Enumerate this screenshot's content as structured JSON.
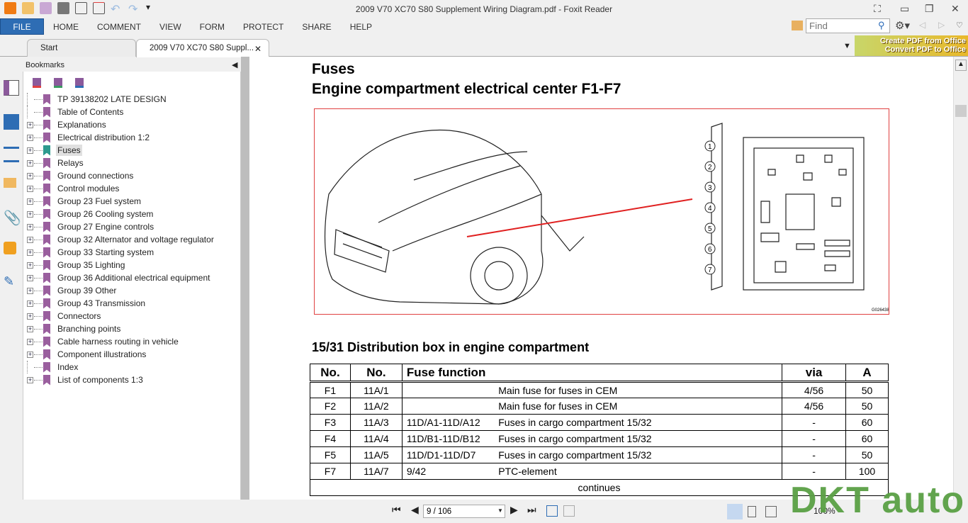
{
  "window": {
    "title": "2009 V70 XC70 S80 Supplement Wiring Diagram.pdf - Foxit Reader"
  },
  "menu": {
    "file": "FILE",
    "items": [
      "HOME",
      "COMMENT",
      "VIEW",
      "FORM",
      "PROTECT",
      "SHARE",
      "HELP"
    ]
  },
  "search": {
    "placeholder": "Find"
  },
  "tabs": [
    {
      "label": "Start"
    },
    {
      "label": "2009 V70 XC70 S80 Suppl..."
    }
  ],
  "banner": {
    "line1": "Create PDF from Office",
    "line2": "Convert PDF to Office"
  },
  "bookmarks": {
    "title": "Bookmarks",
    "items": [
      {
        "label": "TP 39138202 LATE DESIGN",
        "expandable": false
      },
      {
        "label": "Table of Contents",
        "expandable": false
      },
      {
        "label": "Explanations",
        "expandable": true
      },
      {
        "label": "Electrical distribution 1:2",
        "expandable": true
      },
      {
        "label": "Fuses",
        "expandable": true,
        "selected": true
      },
      {
        "label": "Relays",
        "expandable": true
      },
      {
        "label": "Ground connections",
        "expandable": true
      },
      {
        "label": "Control modules",
        "expandable": true
      },
      {
        "label": "Group 23 Fuel system",
        "expandable": true
      },
      {
        "label": "Group 26 Cooling system",
        "expandable": true
      },
      {
        "label": "Group 27 Engine controls",
        "expandable": true
      },
      {
        "label": "Group 32 Alternator and voltage regulator",
        "expandable": true
      },
      {
        "label": "Group 33 Starting system",
        "expandable": true
      },
      {
        "label": "Group 35 Lighting",
        "expandable": true
      },
      {
        "label": "Group 36 Additional electrical equipment",
        "expandable": true
      },
      {
        "label": "Group 39 Other",
        "expandable": true
      },
      {
        "label": "Group 43 Transmission",
        "expandable": true
      },
      {
        "label": "Connectors",
        "expandable": true
      },
      {
        "label": "Branching points",
        "expandable": true
      },
      {
        "label": "Cable harness routing in vehicle",
        "expandable": true
      },
      {
        "label": "Component illustrations",
        "expandable": true
      },
      {
        "label": "Index",
        "expandable": false
      },
      {
        "label": "List of components 1:3",
        "expandable": true
      }
    ]
  },
  "document": {
    "title1": "Fuses",
    "title2": "Engine compartment electrical center F1-F7",
    "figure_labels": [
      "1",
      "2",
      "3",
      "4",
      "5",
      "6",
      "7"
    ],
    "figure_code": "G026438",
    "section": "15/31 Distribution box in engine compartment",
    "table": {
      "headers": [
        "No.",
        "No.",
        "Fuse function",
        "via",
        "A"
      ],
      "rows": [
        [
          "F1",
          "11A/1",
          "",
          "Main fuse for fuses in CEM",
          "4/56",
          "50"
        ],
        [
          "F2",
          "11A/2",
          "",
          "Main fuse for fuses in CEM",
          "4/56",
          "50"
        ],
        [
          "F3",
          "11A/3",
          "11D/A1-11D/A12",
          "Fuses in cargo compartment 15/32",
          "-",
          "60"
        ],
        [
          "F4",
          "11A/4",
          "11D/B1-11D/B12",
          "Fuses in cargo compartment 15/32",
          "-",
          "60"
        ],
        [
          "F5",
          "11A/5",
          "11D/D1-11D/D7",
          "Fuses in cargo compartment 15/32",
          "-",
          "50"
        ],
        [
          "F7",
          "11A/7",
          "9/42",
          "PTC-element",
          "-",
          "100"
        ]
      ],
      "footer": "continues"
    }
  },
  "status": {
    "page": "9 / 106",
    "zoom": "100%"
  },
  "watermark": "DKT auto"
}
